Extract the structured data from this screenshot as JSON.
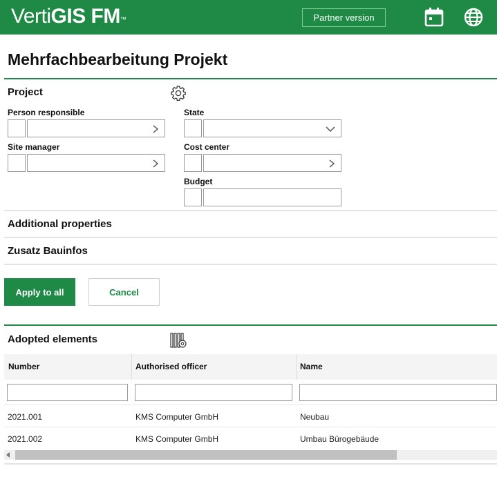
{
  "header": {
    "brand_light": "Verti",
    "brand_bold": "GIS FM",
    "brand_tm": "™",
    "partner_label": "Partner version",
    "icons": [
      "calendar-icon",
      "globe-icon"
    ]
  },
  "page": {
    "title": "Mehrfachbearbeitung Projekt"
  },
  "project": {
    "title": "Project",
    "fields": {
      "person_responsible": "Person responsible",
      "site_manager": "Site manager",
      "state": "State",
      "cost_center": "Cost center",
      "budget": "Budget"
    }
  },
  "sections": {
    "additional": "Additional properties",
    "zusatz": "Zusatz Bauinfos"
  },
  "actions": {
    "apply": "Apply to all",
    "cancel": "Cancel"
  },
  "adopted": {
    "title": "Adopted elements",
    "columns": [
      "Number",
      "Authorised officer",
      "Name"
    ],
    "rows": [
      [
        "2021.001",
        "KMS Computer GmbH",
        "Neubau"
      ],
      [
        "2021.002",
        "KMS Computer GmbH",
        "Umbau Bürogebäude"
      ]
    ]
  },
  "colors": {
    "brand_green": "#1e8a45",
    "border_grey": "#9a9a9a"
  }
}
